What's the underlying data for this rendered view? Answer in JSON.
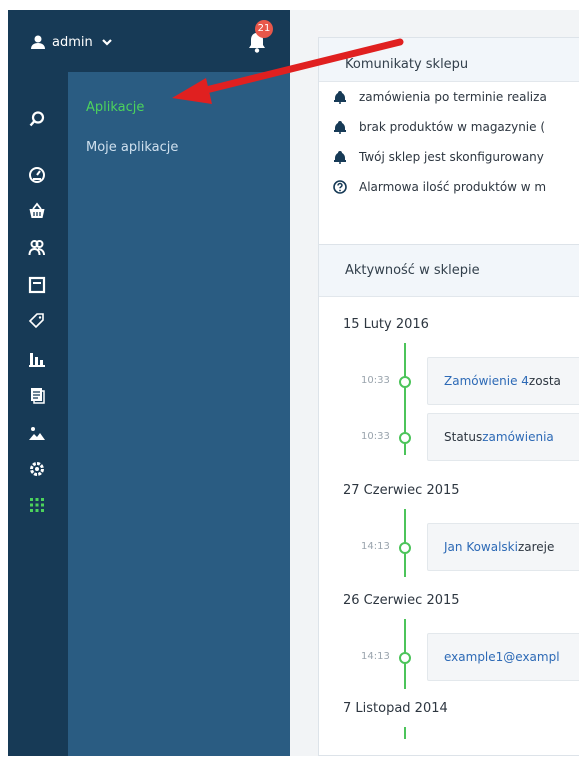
{
  "header": {
    "user_label": "admin",
    "notification_count": "21"
  },
  "sidebar": {
    "icons": [
      "search-icon",
      "speedometer-icon",
      "basket-icon",
      "users-icon",
      "box-icon",
      "tag-icon",
      "chart-icon",
      "document-icon",
      "image-icon",
      "gear-icon",
      "apps-grid-icon"
    ],
    "submenu": [
      {
        "label": "Aplikacje",
        "active": true
      },
      {
        "label": "Moje aplikacje",
        "active": false
      }
    ]
  },
  "notices_card": {
    "title": "Komunikaty sklepu",
    "items": [
      {
        "icon": "alarm-bell-icon",
        "text": "zamówienia po terminie realiza"
      },
      {
        "icon": "alarm-bell-icon",
        "text": "brak produktów w magazynie ("
      },
      {
        "icon": "alarm-bell-icon",
        "text": "Twój sklep jest skonfigurowany"
      },
      {
        "icon": "question-circle-icon",
        "text": "Alarmowa ilość produktów w m"
      }
    ]
  },
  "activity_card": {
    "title": "Aktywność w sklepie",
    "groups": [
      {
        "date": "15 Luty 2016",
        "events": [
          {
            "time": "10:33",
            "link": "Zamówienie 4",
            "text": " zosta"
          },
          {
            "time": "10:33",
            "pre": "Status ",
            "link": "zamówienia",
            "text": ""
          }
        ]
      },
      {
        "date": "27 Czerwiec 2015",
        "events": [
          {
            "time": "14:13",
            "link": "Jan Kowalski",
            "text": " zareje"
          }
        ]
      },
      {
        "date": "26 Czerwiec 2015",
        "events": [
          {
            "time": "14:13",
            "link": "example1@exampl",
            "text": ""
          }
        ]
      },
      {
        "date": "7 Listopad 2014",
        "events": []
      }
    ]
  },
  "colors": {
    "sidebar_dark": "#173a56",
    "sidebar_panel": "#2a5c82",
    "active_green": "#4cd35c",
    "timeline_green": "#4cc45a",
    "link_blue": "#2d6ab6",
    "badge_red": "#e8574a",
    "annotation_arrow": "#e02020"
  }
}
